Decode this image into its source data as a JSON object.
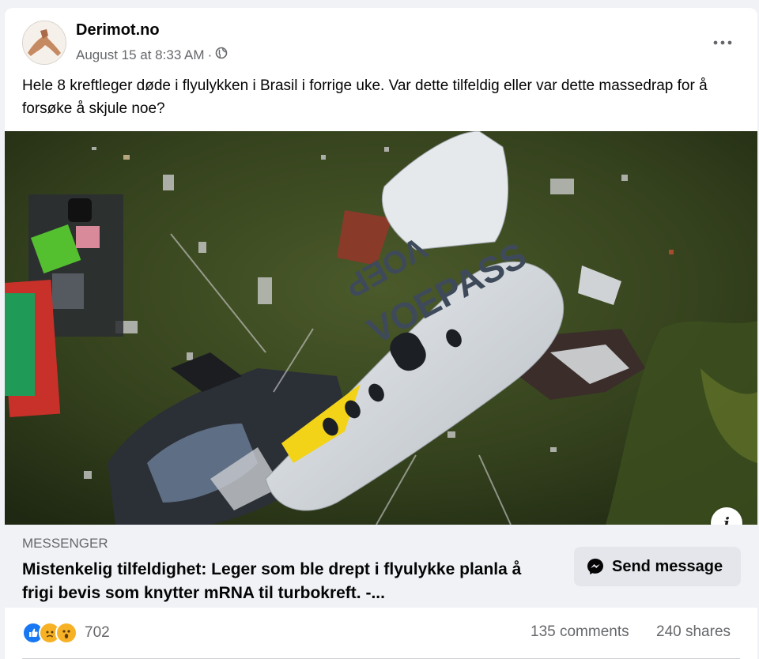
{
  "post": {
    "author": "Derimot.no",
    "timestamp": "August 15 at 8:33 AM",
    "separator": "·",
    "privacy_icon": "globe-icon",
    "menu_icon": "more-horizontal-icon",
    "text": "Hele 8 kreftleger døde i flyulykken i Brasil i forrige uke. Var dette tilfeldig eller var dette massedrap for å forsøke å skjule noe?"
  },
  "image": {
    "fuselage_text": "VOEPASS",
    "tail_text": "VOEP"
  },
  "link_preview": {
    "source": "MESSENGER",
    "title": "Mistenkelig tilfeldighet: Leger som ble drept i flyulykke planla å frigi bevis som knytter mRNA til turbokreft. -...",
    "button_label": "Send message",
    "button_icon": "messenger-icon",
    "info_icon": "info-icon"
  },
  "engagement": {
    "reaction_icons": [
      "like-icon",
      "sad-icon",
      "wow-icon"
    ],
    "reaction_count": "702",
    "comments": "135 comments",
    "shares": "240 shares"
  },
  "colors": {
    "like": "#1877f2",
    "sad": "#f7b125",
    "wow": "#f7b125",
    "muted_text": "#65676b",
    "link_box_bg": "#f0f2f5"
  }
}
